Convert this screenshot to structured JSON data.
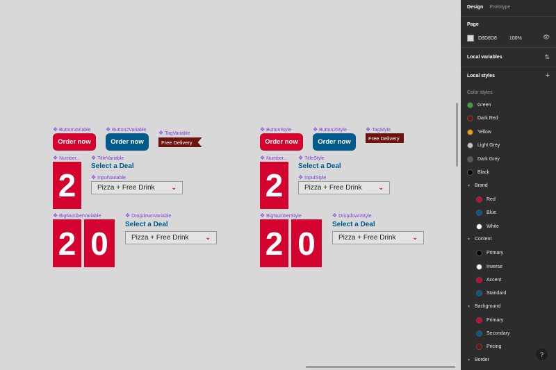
{
  "page": {
    "background": "#D8D8D8"
  },
  "variable_set": {
    "button_label": "ButtonVariable",
    "button2_label": "Button2Variable",
    "tag_label": "TagVariable",
    "number_label": "Number...",
    "title_label": "TitleVariable",
    "input_label": "InputVariable",
    "bignumber_label": "BigNumberVariable",
    "dropdown_label": "DropdownVariable"
  },
  "style_set": {
    "button_label": "ButtonStyle",
    "button2_label": "Button2Style",
    "tag_label": "TagStyle",
    "number_label": "Number...",
    "title_label": "TitleStyle",
    "input_label": "InputStyle",
    "bignumber_label": "BigNumberStyle",
    "dropdown_label": "DropdownStyle"
  },
  "content": {
    "order_now": "Order now",
    "free_delivery": "Free Delivery",
    "number": "2",
    "big_digit_1": "2",
    "big_digit_2": "0",
    "title": "Select a Deal",
    "dropdown_value": "Pizza + Free Drink",
    "chevron": "⌄"
  },
  "panel": {
    "tabs": [
      "Design",
      "Prototype"
    ],
    "page_section": "Page",
    "page_color": "D8D8D8",
    "page_opacity": "100%",
    "local_variables": "Local variables",
    "local_styles": "Local styles",
    "color_styles": "Color styles",
    "styles": [
      {
        "name": "Green",
        "color": "#3fa535"
      },
      {
        "name": "Dark Red",
        "color": "#6b1410"
      },
      {
        "name": "Yellow",
        "color": "#f2a100"
      },
      {
        "name": "Light Grey",
        "color": "#c6c6c6"
      },
      {
        "name": "Dark Grey",
        "color": "#5a5a5a"
      },
      {
        "name": "Black",
        "color": "#000000"
      }
    ],
    "groups": [
      {
        "name": "Brand",
        "items": [
          {
            "name": "Red",
            "color": "#d4022f"
          },
          {
            "name": "Blue",
            "color": "#005a8c"
          },
          {
            "name": "White",
            "color": "#ffffff"
          }
        ]
      },
      {
        "name": "Content",
        "items": [
          {
            "name": "Primary",
            "color": "#000000"
          },
          {
            "name": "Inverse",
            "color": "#ffffff"
          },
          {
            "name": "Accent",
            "color": "#d4022f"
          },
          {
            "name": "Standard",
            "color": "#005a8c"
          }
        ]
      },
      {
        "name": "Background",
        "items": [
          {
            "name": "Primary",
            "color": "#d4022f"
          },
          {
            "name": "Secondary",
            "color": "#005a8c"
          },
          {
            "name": "Pricing",
            "color": "#6b1410"
          }
        ]
      },
      {
        "name": "Border",
        "items": []
      }
    ],
    "help": "?"
  }
}
